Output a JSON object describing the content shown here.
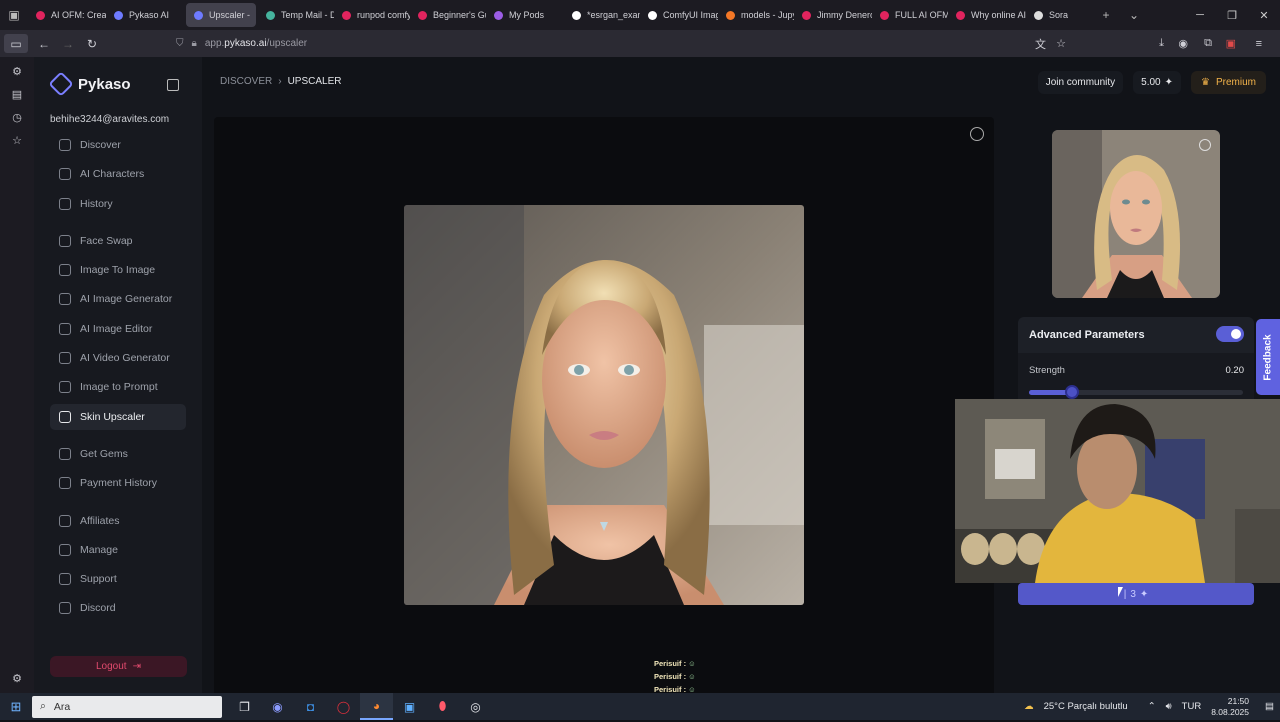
{
  "browser": {
    "tabs": [
      {
        "label": "AI OFM: Crea",
        "color": "#e0245e"
      },
      {
        "label": "Pykaso AI",
        "color": "#6e7bff"
      },
      {
        "label": "Upscaler -",
        "color": "#6e7bff",
        "active": true
      },
      {
        "label": "Temp Mail - D",
        "color": "#45b39d"
      },
      {
        "label": "runpod comfy",
        "color": "#e0245e"
      },
      {
        "label": "Beginner's Gu",
        "color": "#e0245e"
      },
      {
        "label": "My Pods",
        "color": "#9b5de5"
      },
      {
        "label": "*esrgan_exam",
        "color": "#ffffff"
      },
      {
        "label": "ComfyUI Imag",
        "color": "#ffffff"
      },
      {
        "label": "models - Jupy",
        "color": "#f37726"
      },
      {
        "label": "Jimmy Denero",
        "color": "#e0245e"
      },
      {
        "label": "FULL AI OFM",
        "color": "#e0245e"
      },
      {
        "label": "Why online AI",
        "color": "#e0245e"
      },
      {
        "label": "Sora",
        "color": "#dddddd"
      }
    ],
    "url_prefix": "app.",
    "url_host": "pykaso.ai",
    "url_path": "/upscaler"
  },
  "sidebar": {
    "brand": "Pykaso",
    "email": "behihe3244@aravites.com",
    "groups": [
      [
        "Discover",
        "AI Characters",
        "History"
      ],
      [
        "Face Swap",
        "Image To Image",
        "AI Image Generator",
        "AI Image Editor",
        "AI Video Generator",
        "Image to Prompt",
        "Skin Upscaler"
      ],
      [
        "Get Gems",
        "Payment History"
      ],
      [
        "Affiliates",
        "Manage",
        "Support",
        "Discord"
      ]
    ],
    "active": "Skin Upscaler",
    "logout": "Logout"
  },
  "header": {
    "crumb_parent": "DISCOVER",
    "crumb_current": "UPSCALER",
    "join": "Join community",
    "credits": "5.00",
    "premium": "Premium"
  },
  "panel": {
    "advanced_title": "Advanced Parameters",
    "advanced_enabled": true,
    "strength_label": "Strength",
    "strength_value": "0.20",
    "strength_fraction": 0.2,
    "upscale_cost": "3",
    "feedback": "Feedback"
  },
  "chatlog": [
    "Perisuif :",
    "Perisuif :",
    "Perisuif :",
    "Perisuif :",
    "Perisuif :"
  ],
  "taskbar": {
    "search": "Ara",
    "weather": "25°C  Parçalı bulutlu",
    "lang": "TUR",
    "time": "21:50",
    "date": "8.08.2025"
  },
  "colors": {
    "accent": "#5a5fd6",
    "premium": "#f3b34a",
    "logout": "#e04a6d"
  }
}
